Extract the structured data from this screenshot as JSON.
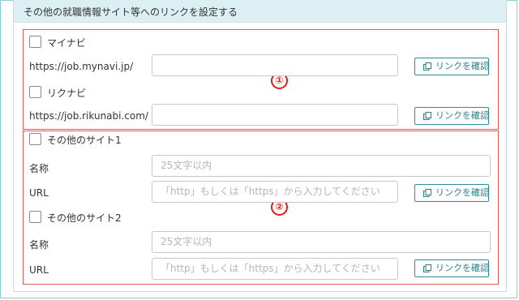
{
  "header": {
    "title": "その他の就職情報サイト等へのリンクを設定する"
  },
  "markers": {
    "group1": "①",
    "group2": "②"
  },
  "sites": {
    "mynavi": {
      "name": "マイナビ",
      "url": "https://job.mynavi.jp/",
      "button": "リンクを確認"
    },
    "rikunabi": {
      "name": "リクナビ",
      "url": "https://job.rikunabi.com/",
      "button": "リンクを確認"
    },
    "other1": {
      "name": "その他のサイト1",
      "name_label": "名称",
      "name_placeholder": "25文字以内",
      "url_label": "URL",
      "url_placeholder": "「http」もしくは「https」から入力してください",
      "button": "リンクを確認"
    },
    "other2": {
      "name": "その他のサイト2",
      "name_label": "名称",
      "name_placeholder": "25文字以内",
      "url_label": "URL",
      "url_placeholder": "「http」もしくは「https」から入力してください",
      "button": "リンクを確認"
    }
  },
  "colors": {
    "accent": "#2f8d96",
    "header_bg": "#dcf0f3",
    "highlight": "#e31b1b"
  },
  "icons": {
    "confirm": "copy-icon"
  }
}
